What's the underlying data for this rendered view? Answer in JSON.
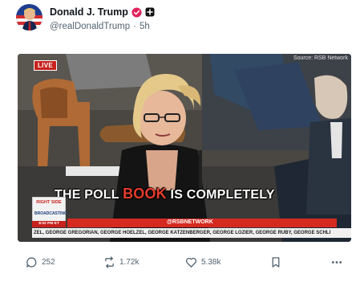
{
  "post": {
    "author": {
      "display_name": "Donald J. Trump",
      "handle": "@realDonaldTrump",
      "separator": "·",
      "time": "5h",
      "verified_icon": "verified-badge-icon",
      "affiliation_icon": "affiliation-badge-icon"
    },
    "media": {
      "live_label": "LIVE",
      "source": "Source: RSB Network",
      "caption_pre": "THE POLL",
      "caption_highlight": "BOOK",
      "caption_post": "IS COMPLETELY",
      "logo_top": "RIGHT SIDE",
      "logo_bottom": "BROADCASTING",
      "logo_time": "8:02 PM ET",
      "ticker_handle": "@RSBNETWORK",
      "ticker_names": "ZEL, GEORGE GREGORIAN, GEORGE HOELZEL, GEORGE KATZENBERGER, GEORGE LOZIER, GEORGE RUBY, GEORGE SCHLI"
    },
    "actions": {
      "replies": "252",
      "reposts": "1.72k",
      "likes": "5.38k"
    }
  },
  "colors": {
    "accent_verified": "#e0245e",
    "live_red": "#c8221d",
    "caption_highlight": "#e63c2b",
    "muted_text": "#536471"
  }
}
